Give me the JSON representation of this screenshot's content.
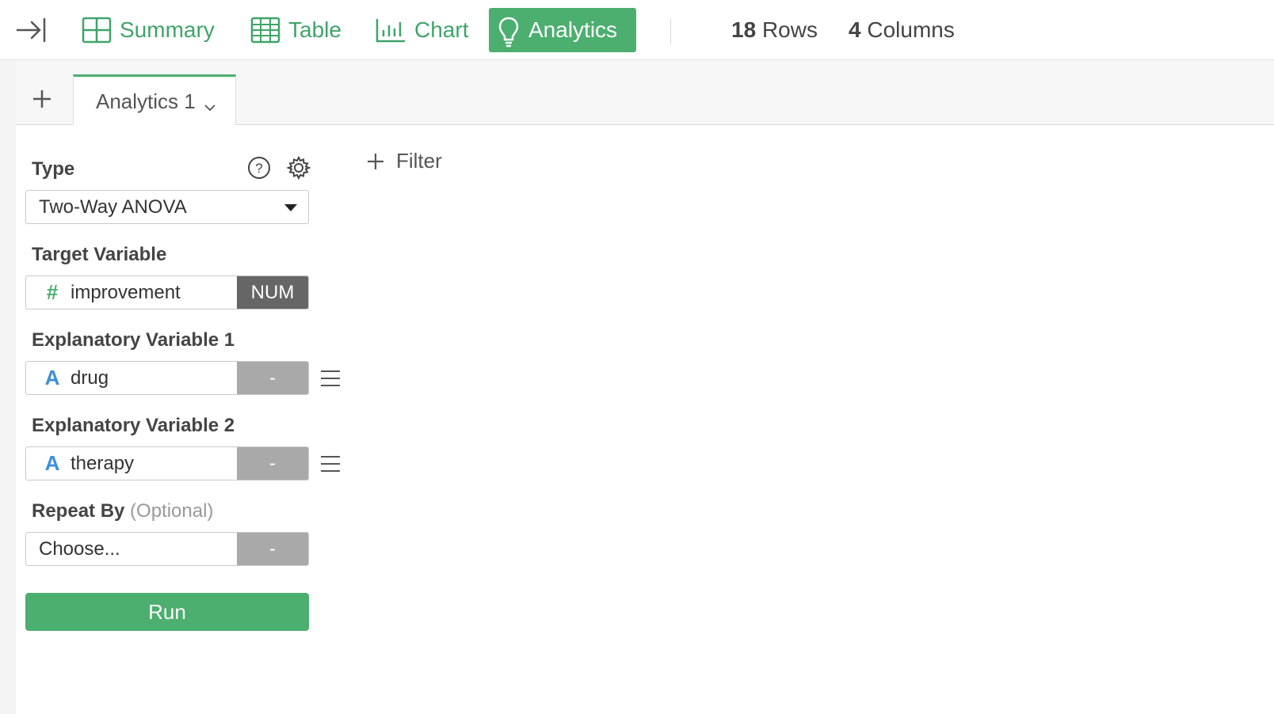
{
  "toolbar": {
    "tabs": [
      {
        "label": "Summary",
        "icon": "summary-grid-icon"
      },
      {
        "label": "Table",
        "icon": "table-grid-icon"
      },
      {
        "label": "Chart",
        "icon": "bar-chart-icon"
      },
      {
        "label": "Analytics",
        "icon": "lightbulb-icon",
        "active": true
      }
    ],
    "rows_count": "18",
    "rows_label": "Rows",
    "cols_count": "4",
    "cols_label": "Columns"
  },
  "tabs": {
    "current": "Analytics 1"
  },
  "panel": {
    "type_label": "Type",
    "type_value": "Two-Way ANOVA",
    "target_label": "Target Variable",
    "target": {
      "name": "improvement",
      "type": "NUM",
      "icon": "#"
    },
    "exp1_label": "Explanatory Variable 1",
    "exp1": {
      "name": "drug",
      "type": "-",
      "icon": "A"
    },
    "exp2_label": "Explanatory Variable 2",
    "exp2": {
      "name": "therapy",
      "type": "-",
      "icon": "A"
    },
    "repeat_label": "Repeat By",
    "repeat_optional": "(Optional)",
    "repeat": {
      "placeholder": "Choose...",
      "type": "-"
    },
    "run_label": "Run"
  },
  "filter_label": "Filter",
  "colors": {
    "accent": "#4cae6f",
    "categorical": "#3c8fd6",
    "badge_dark": "#666666",
    "badge_light": "#a9a9a9"
  }
}
